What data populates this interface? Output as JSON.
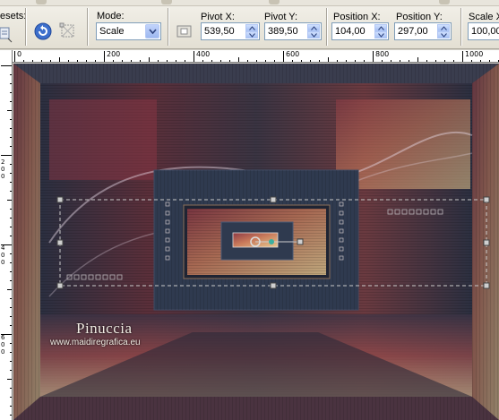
{
  "toolbar": {
    "presets_label": "esets:",
    "mode": {
      "label": "Mode:",
      "value": "Scale"
    },
    "pivot_x": {
      "label": "Pivot X:",
      "value": "539,50"
    },
    "pivot_y": {
      "label": "Pivot Y:",
      "value": "389,50"
    },
    "position_x": {
      "label": "Position X:",
      "value": "104,00"
    },
    "position_y": {
      "label": "Position Y:",
      "value": "297,00"
    },
    "scale_x": {
      "label": "Scale X(",
      "value": "100,00"
    }
  },
  "ruler": {
    "horizontal_labels": [
      "0",
      "200",
      "400",
      "600",
      "800",
      "1000"
    ],
    "vertical_labels": [
      {
        "digits": [
          "2",
          "0",
          "0"
        ]
      },
      {
        "digits": [
          "4",
          "0",
          "0"
        ]
      },
      {
        "digits": [
          "6",
          "0",
          "0"
        ]
      }
    ]
  },
  "image": {
    "watermark_name": "Pinuccia",
    "watermark_url": "www.maidiregrafica.eu"
  },
  "icons": [
    "presets-dropdown-icon",
    "reset-arrow-icon",
    "move-grid-icon",
    "pivot-center-icon"
  ],
  "colors": {
    "spin_border": "#7f9db9",
    "accent_blue": "#3d6fcc"
  }
}
